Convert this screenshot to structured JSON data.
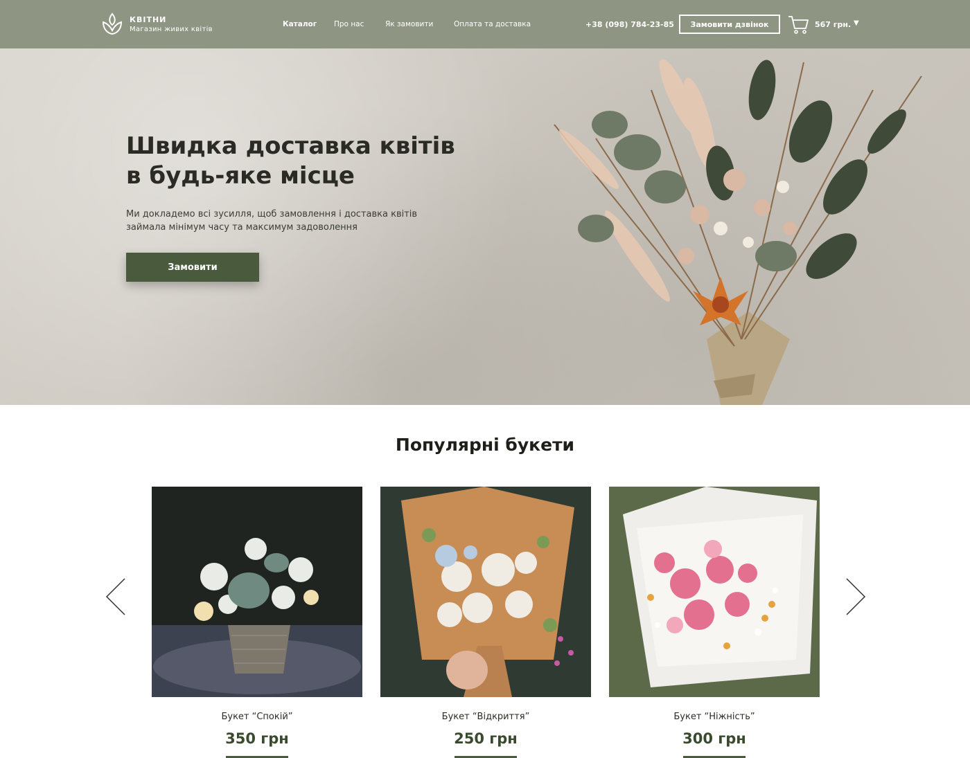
{
  "header": {
    "logo_title": "КВІТНИ",
    "logo_subtitle": "Магазин живих квітів",
    "nav": [
      {
        "label": "Каталог",
        "active": true
      },
      {
        "label": "Про нас",
        "active": false
      },
      {
        "label": "Як замовити",
        "active": false
      },
      {
        "label": "Оплата та доставка",
        "active": false
      }
    ],
    "phone": "+38 (098) 784-23-85",
    "call_button": "Замовити дзвінок",
    "cart_total": "567 грн.",
    "cart_icon": "cart-icon",
    "dropdown_icon": "caret-down-icon"
  },
  "hero": {
    "title": "Швидка доставка квітів\nв будь-яке місце",
    "text": "Ми докладемо всі зусилля, щоб замовлення і доставка квітів\nзаймала мінімум часу та максимум задоволення",
    "button": "Замовити"
  },
  "popular": {
    "title": "Популярні букети",
    "items": [
      {
        "name": "Букет “Спокій”",
        "price": "350 грн"
      },
      {
        "name": "Букет “Відкриття”",
        "price": "250 грн"
      },
      {
        "name": "Букет “Ніжність”",
        "price": "300 грн"
      }
    ]
  },
  "colors": {
    "header_bg": "#8e9683",
    "accent": "#4a5a3c",
    "text_dark": "#2b2b25"
  }
}
